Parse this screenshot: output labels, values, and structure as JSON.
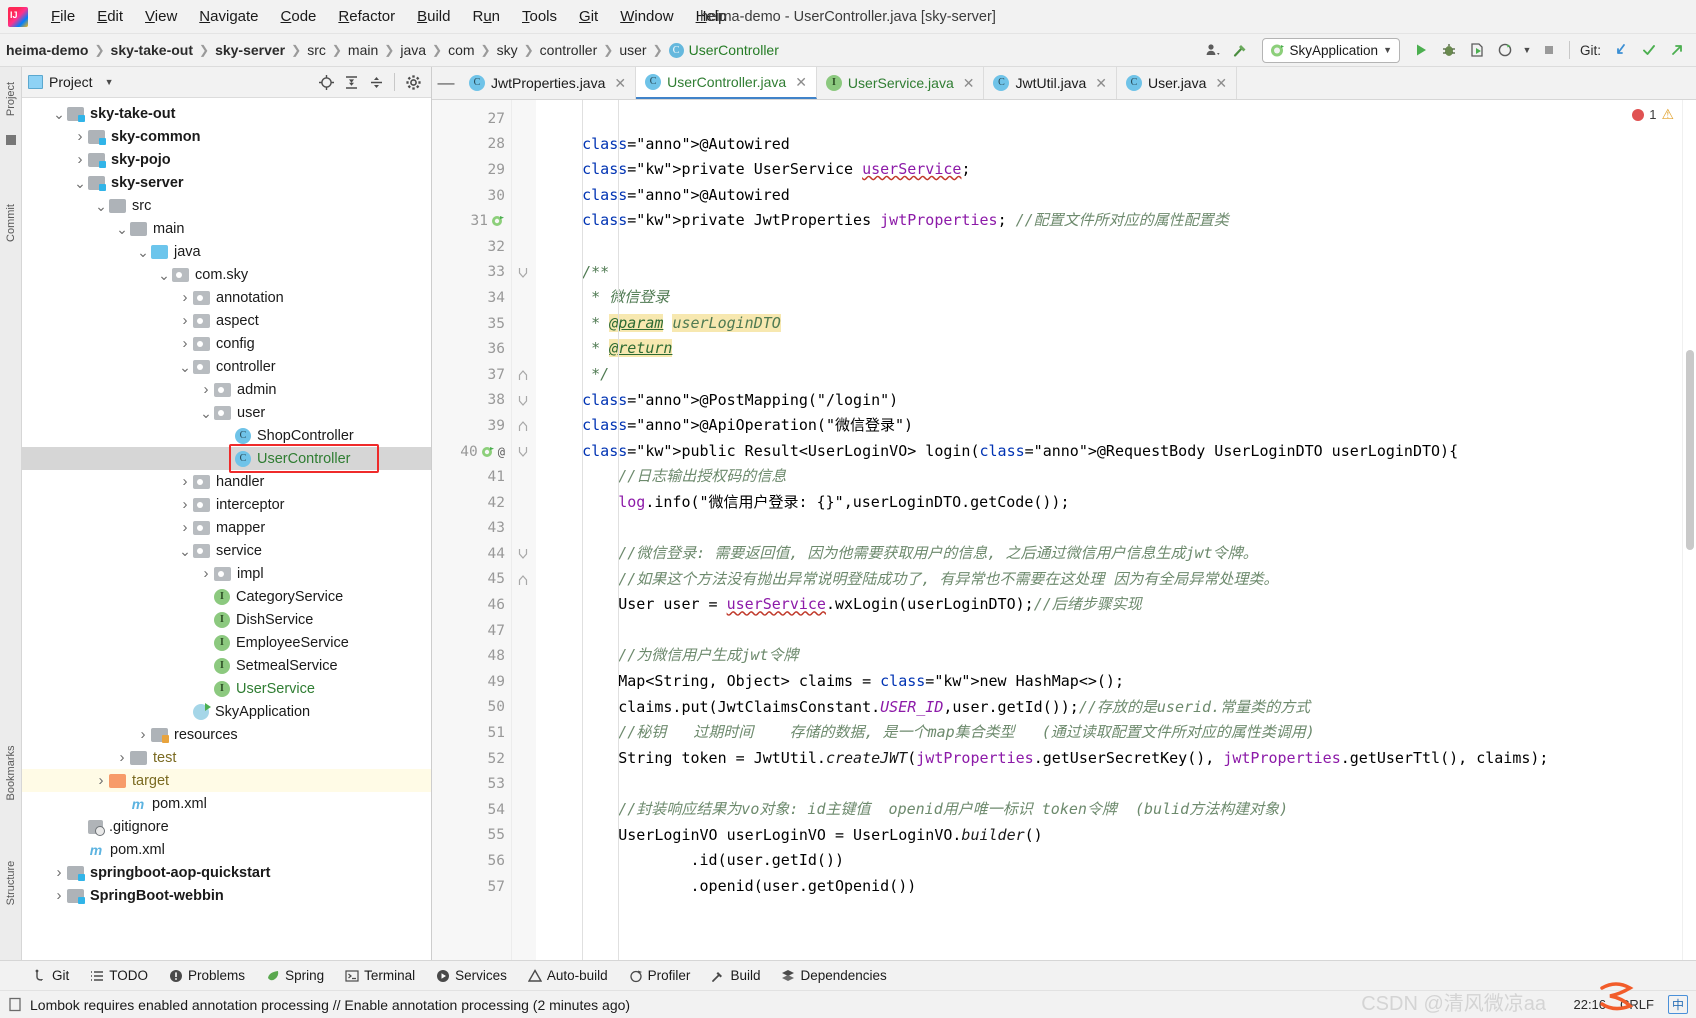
{
  "window": {
    "title": "heima-demo - UserController.java [sky-server]",
    "app_icon": "intellij-idea-logo"
  },
  "menubar": {
    "items": [
      "File",
      "Edit",
      "View",
      "Navigate",
      "Code",
      "Refactor",
      "Build",
      "Run",
      "Tools",
      "Git",
      "Window",
      "Help"
    ]
  },
  "navbar": {
    "breadcrumbs": [
      {
        "label": "heima-demo",
        "bold": true
      },
      {
        "label": "sky-take-out",
        "bold": true
      },
      {
        "label": "sky-server",
        "bold": true
      },
      {
        "label": "src",
        "bold": false
      },
      {
        "label": "main",
        "bold": false
      },
      {
        "label": "java",
        "bold": false
      },
      {
        "label": "com",
        "bold": false
      },
      {
        "label": "sky",
        "bold": false
      },
      {
        "label": "controller",
        "bold": false
      },
      {
        "label": "user",
        "bold": false
      }
    ],
    "current_class": "UserController",
    "current_class_icon": "class-icon",
    "run_config": "SkyApplication",
    "git_label": "Git:",
    "icons": [
      "user-avatar-icon",
      "hammer-icon",
      "run-icon",
      "debug-icon",
      "run-coverage-icon",
      "profiler-icon",
      "stop-icon",
      "git-update-icon",
      "git-commit-icon",
      "git-push-icon"
    ]
  },
  "project_panel": {
    "title": "Project",
    "tools": [
      "locate-icon",
      "expand-all-icon",
      "collapse-all-icon",
      "settings-gear-icon"
    ],
    "tree": [
      {
        "indent": 1,
        "arrow": "down",
        "icon": "module-folder",
        "label": "sky-take-out",
        "bold": true
      },
      {
        "indent": 2,
        "arrow": "right",
        "icon": "module-folder",
        "label": "sky-common",
        "bold": true
      },
      {
        "indent": 2,
        "arrow": "right",
        "icon": "module-folder",
        "label": "sky-pojo",
        "bold": true
      },
      {
        "indent": 2,
        "arrow": "down",
        "icon": "module-folder",
        "label": "sky-server",
        "bold": true
      },
      {
        "indent": 3,
        "arrow": "down",
        "icon": "folder",
        "label": "src",
        "bold": false
      },
      {
        "indent": 4,
        "arrow": "down",
        "icon": "folder",
        "label": "main",
        "bold": false
      },
      {
        "indent": 5,
        "arrow": "down",
        "icon": "source-folder",
        "label": "java",
        "bold": false
      },
      {
        "indent": 6,
        "arrow": "down",
        "icon": "package",
        "label": "com.sky",
        "bold": false
      },
      {
        "indent": 7,
        "arrow": "right",
        "icon": "package",
        "label": "annotation",
        "bold": false
      },
      {
        "indent": 7,
        "arrow": "right",
        "icon": "package",
        "label": "aspect",
        "bold": false
      },
      {
        "indent": 7,
        "arrow": "right",
        "icon": "package",
        "label": "config",
        "bold": false
      },
      {
        "indent": 7,
        "arrow": "down",
        "icon": "package",
        "label": "controller",
        "bold": false
      },
      {
        "indent": 8,
        "arrow": "right",
        "icon": "package",
        "label": "admin",
        "bold": false
      },
      {
        "indent": 8,
        "arrow": "down",
        "icon": "package",
        "label": "user",
        "bold": false
      },
      {
        "indent": 9,
        "arrow": "none",
        "icon": "class",
        "label": "ShopController",
        "bold": false
      },
      {
        "indent": 9,
        "arrow": "none",
        "icon": "class",
        "label": "UserController",
        "bold": false,
        "selected": true,
        "highlight_box": true,
        "green": true
      },
      {
        "indent": 7,
        "arrow": "right",
        "icon": "package",
        "label": "handler",
        "bold": false
      },
      {
        "indent": 7,
        "arrow": "right",
        "icon": "package",
        "label": "interceptor",
        "bold": false
      },
      {
        "indent": 7,
        "arrow": "right",
        "icon": "package",
        "label": "mapper",
        "bold": false
      },
      {
        "indent": 7,
        "arrow": "down",
        "icon": "package",
        "label": "service",
        "bold": false
      },
      {
        "indent": 8,
        "arrow": "right",
        "icon": "package",
        "label": "impl",
        "bold": false
      },
      {
        "indent": 8,
        "arrow": "none",
        "icon": "interface",
        "label": "CategoryService",
        "bold": false
      },
      {
        "indent": 8,
        "arrow": "none",
        "icon": "interface",
        "label": "DishService",
        "bold": false
      },
      {
        "indent": 8,
        "arrow": "none",
        "icon": "interface",
        "label": "EmployeeService",
        "bold": false
      },
      {
        "indent": 8,
        "arrow": "none",
        "icon": "interface",
        "label": "SetmealService",
        "bold": false
      },
      {
        "indent": 8,
        "arrow": "none",
        "icon": "interface",
        "label": "UserService",
        "bold": false,
        "green": true
      },
      {
        "indent": 7,
        "arrow": "none",
        "icon": "spring-boot",
        "label": "SkyApplication",
        "bold": false
      },
      {
        "indent": 5,
        "arrow": "right",
        "icon": "resources-folder",
        "label": "resources",
        "bold": false
      },
      {
        "indent": 4,
        "arrow": "right",
        "icon": "folder",
        "label": "test",
        "bold": false,
        "olive": true
      },
      {
        "indent": 3,
        "arrow": "right",
        "icon": "target-folder",
        "label": "target",
        "bold": false,
        "olive": true,
        "row_highlight": true
      },
      {
        "indent": 4,
        "arrow": "none",
        "icon": "maven",
        "label": "pom.xml",
        "bold": false
      },
      {
        "indent": 2,
        "arrow": "none",
        "icon": "gitignore",
        "label": ".gitignore",
        "bold": false
      },
      {
        "indent": 2,
        "arrow": "none",
        "icon": "maven",
        "label": "pom.xml",
        "bold": false
      },
      {
        "indent": 1,
        "arrow": "right",
        "icon": "module-folder",
        "label": "springboot-aop-quickstart",
        "bold": true
      },
      {
        "indent": 1,
        "arrow": "right",
        "icon": "module-folder",
        "label": "SpringBoot-webbin",
        "bold": true
      }
    ]
  },
  "left_strip_tabs": [
    "Project",
    "Commit",
    "Bookmarks",
    "Structure"
  ],
  "editor": {
    "tabs": [
      {
        "label": "JwtProperties.java",
        "icon": "class-icon",
        "icon_type": "class",
        "active": false,
        "green": false
      },
      {
        "label": "UserController.java",
        "icon": "class-icon",
        "icon_type": "class",
        "active": true,
        "green": true
      },
      {
        "label": "UserService.java",
        "icon": "interface-icon",
        "icon_type": "interface",
        "active": false,
        "green": true
      },
      {
        "label": "JwtUtil.java",
        "icon": "class-icon",
        "icon_type": "class",
        "active": false,
        "green": false
      },
      {
        "label": "User.java",
        "icon": "class-icon",
        "icon_type": "class",
        "active": false,
        "green": false
      }
    ],
    "inspection": {
      "errors": "1",
      "error_icon": "error-dot-icon",
      "warning_icon": "warning-triangle-icon"
    },
    "first_line_number": 27,
    "lines": [
      {
        "n": 27,
        "text": ""
      },
      {
        "n": 28,
        "text": "    @Autowired"
      },
      {
        "n": 29,
        "text": "    private UserService userService;"
      },
      {
        "n": 30,
        "text": "    @Autowired"
      },
      {
        "n": 31,
        "text": "    private JwtProperties jwtProperties; //配置文件所对应的属性配置类",
        "gutter_icon": "spring-bean-icon"
      },
      {
        "n": 32,
        "text": ""
      },
      {
        "n": 33,
        "text": "    /**",
        "fold": "down"
      },
      {
        "n": 34,
        "text": "     * 微信登录"
      },
      {
        "n": 35,
        "text": "     * @param userLoginDTO"
      },
      {
        "n": 36,
        "text": "     * @return"
      },
      {
        "n": 37,
        "text": "     */",
        "fold": "up"
      },
      {
        "n": 38,
        "text": "    @PostMapping(\"/login\")",
        "fold": "down"
      },
      {
        "n": 39,
        "text": "    @ApiOperation(\"微信登录\")",
        "fold": "up"
      },
      {
        "n": 40,
        "text": "    public Result<UserLoginVO> login(@RequestBody UserLoginDTO userLoginDTO){",
        "gutter_icon": "spring-endpoint-icon",
        "gutter_icon2": "override-icon",
        "fold": "down"
      },
      {
        "n": 41,
        "text": "        //日志输出授权码的信息"
      },
      {
        "n": 42,
        "text": "        log.info(\"微信用户登录: {}\",userLoginDTO.getCode());"
      },
      {
        "n": 43,
        "text": ""
      },
      {
        "n": 44,
        "text": "        //微信登录: 需要返回值, 因为他需要获取用户的信息, 之后通过微信用户信息生成jwt令牌。",
        "fold": "down"
      },
      {
        "n": 45,
        "text": "        //如果这个方法没有抛出异常说明登陆成功了, 有异常也不需要在这处理 因为有全局异常处理类。",
        "fold": "up"
      },
      {
        "n": 46,
        "text": "        User user = userService.wxLogin(userLoginDTO);//后绪步骤实现"
      },
      {
        "n": 47,
        "text": ""
      },
      {
        "n": 48,
        "text": "        //为微信用户生成jwt令牌"
      },
      {
        "n": 49,
        "text": "        Map<String, Object> claims = new HashMap<>();"
      },
      {
        "n": 50,
        "text": "        claims.put(JwtClaimsConstant.USER_ID,user.getId());//存放的是userid.常量类的方式"
      },
      {
        "n": 51,
        "text": "        //秘钥   过期时间    存储的数据, 是一个map集合类型   (通过读取配置文件所对应的属性类调用)"
      },
      {
        "n": 52,
        "text": "        String token = JwtUtil.createJWT(jwtProperties.getUserSecretKey(), jwtProperties.getUserTtl(), claims);"
      },
      {
        "n": 53,
        "text": ""
      },
      {
        "n": 54,
        "text": "        //封装响应结果为vo对象: id主键值  openid用户唯一标识 token令牌  (bulid方法构建对象)"
      },
      {
        "n": 55,
        "text": "        UserLoginVO userLoginVO = UserLoginVO.builder()"
      },
      {
        "n": 56,
        "text": "                .id(user.getId())"
      },
      {
        "n": 57,
        "text": "                .openid(user.getOpenid())"
      }
    ]
  },
  "bottom_bar": {
    "items": [
      {
        "label": "Git",
        "icon": "git-branch-icon"
      },
      {
        "label": "TODO",
        "icon": "todo-list-icon"
      },
      {
        "label": "Problems",
        "icon": "problems-icon"
      },
      {
        "label": "Spring",
        "icon": "spring-leaf-icon"
      },
      {
        "label": "Terminal",
        "icon": "terminal-icon"
      },
      {
        "label": "Services",
        "icon": "services-icon"
      },
      {
        "label": "Auto-build",
        "icon": "auto-build-icon"
      },
      {
        "label": "Profiler",
        "icon": "profiler-icon"
      },
      {
        "label": "Build",
        "icon": "build-hammer-icon"
      },
      {
        "label": "Dependencies",
        "icon": "dependencies-icon"
      }
    ]
  },
  "status_bar": {
    "icon": "event-log-icon",
    "message": "Lombok requires enabled annotation processing // Enable annotation processing (2 minutes ago)",
    "time": "22:16",
    "line_separator": "CRLF",
    "ime": "中",
    "watermark": "CSDN @清风微凉aa"
  },
  "colors": {
    "accent_blue": "#4083c9",
    "keyword": "#0033b3",
    "string": "#007a3d",
    "comment": "#6d8a6d",
    "annotation": "#9e880d",
    "field": "#8c1aa8",
    "selection": "#d6d6d6",
    "highlight_red": "#ef2b2b"
  }
}
